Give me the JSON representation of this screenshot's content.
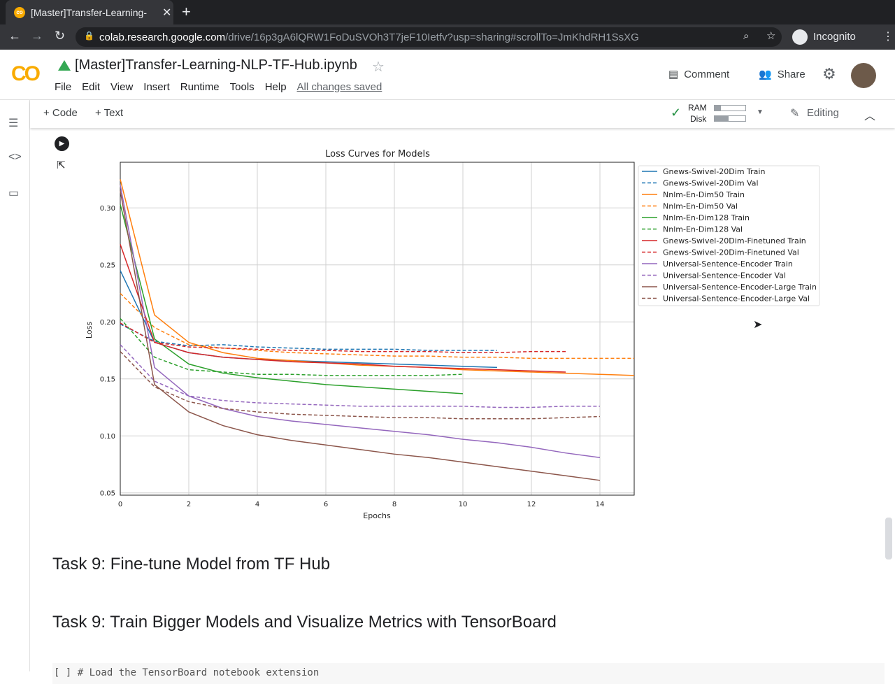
{
  "browser": {
    "tab_title": "[Master]Transfer-Learning-",
    "url_host": "colab.research.google.com",
    "url_path": "/drive/16p3gA6lQRW1FoDuSVOh3T7jeF10Ietfv?usp=sharing#scrollTo=JmKhdRH1SsXG",
    "incognito_label": "Incognito"
  },
  "header": {
    "logo": "CO",
    "notebook_title": "[Master]Transfer-Learning-NLP-TF-Hub.ipynb",
    "menu": [
      "File",
      "Edit",
      "View",
      "Insert",
      "Runtime",
      "Tools",
      "Help"
    ],
    "save_status": "All changes saved",
    "comment": "Comment",
    "share": "Share"
  },
  "toolbar": {
    "add_code": "+ Code",
    "add_text": "+ Text",
    "ram": "RAM",
    "disk": "Disk",
    "ram_usage": 0.2,
    "disk_usage": 0.45,
    "editing": "Editing"
  },
  "cells": {
    "task9a": "Task 9: Fine-tune Model from TF Hub",
    "task9b": "Task 9: Train Bigger Models and Visualize Metrics with TensorBoard",
    "code_peek": "[ ]  # Load the TensorBoard notebook extension"
  },
  "chart_data": {
    "type": "line",
    "title": "Loss Curves for Models",
    "xlabel": "Epochs",
    "ylabel": "Loss",
    "xlim": [
      0,
      15
    ],
    "ylim": [
      0.048,
      0.34
    ],
    "grid": true,
    "legend_position": "outside-right",
    "xticks": [
      0,
      2,
      4,
      6,
      8,
      10,
      12,
      14
    ],
    "yticks": [
      0.05,
      0.1,
      0.15,
      0.2,
      0.25,
      0.3
    ],
    "series": [
      {
        "name": "Gnews-Swivel-20Dim Train",
        "color": "#1f77b4",
        "dash": false,
        "values": [
          0.245,
          0.182,
          0.173,
          0.169,
          0.167,
          0.166,
          0.165,
          0.164,
          0.163,
          0.162,
          0.161,
          0.16
        ]
      },
      {
        "name": "Gnews-Swivel-20Dim Val",
        "color": "#1f77b4",
        "dash": true,
        "values": [
          0.198,
          0.183,
          0.179,
          0.18,
          0.178,
          0.177,
          0.176,
          0.176,
          0.176,
          0.175,
          0.175,
          0.175
        ]
      },
      {
        "name": "Nnlm-En-Dim50 Train",
        "color": "#ff7f0e",
        "dash": false,
        "values": [
          0.325,
          0.206,
          0.182,
          0.173,
          0.168,
          0.166,
          0.164,
          0.162,
          0.161,
          0.16,
          0.158,
          0.157,
          0.156,
          0.155,
          0.154,
          0.153
        ]
      },
      {
        "name": "Nnlm-En-Dim50 Val",
        "color": "#ff7f0e",
        "dash": true,
        "values": [
          0.225,
          0.195,
          0.18,
          0.177,
          0.175,
          0.173,
          0.172,
          0.171,
          0.17,
          0.17,
          0.169,
          0.169,
          0.168,
          0.168,
          0.168,
          0.168
        ]
      },
      {
        "name": "Nnlm-En-Dim128 Train",
        "color": "#2ca02c",
        "dash": false,
        "values": [
          0.303,
          0.185,
          0.163,
          0.155,
          0.151,
          0.148,
          0.145,
          0.143,
          0.141,
          0.139,
          0.137
        ]
      },
      {
        "name": "Nnlm-En-Dim128 Val",
        "color": "#2ca02c",
        "dash": true,
        "values": [
          0.203,
          0.169,
          0.158,
          0.156,
          0.154,
          0.154,
          0.153,
          0.153,
          0.153,
          0.153,
          0.154
        ]
      },
      {
        "name": "Gnews-Swivel-20Dim-Finetuned Train",
        "color": "#d62728",
        "dash": false,
        "values": [
          0.268,
          0.182,
          0.173,
          0.169,
          0.167,
          0.165,
          0.164,
          0.163,
          0.161,
          0.16,
          0.159,
          0.158,
          0.157,
          0.156
        ]
      },
      {
        "name": "Gnews-Swivel-20Dim-Finetuned Val",
        "color": "#d62728",
        "dash": true,
        "values": [
          0.199,
          0.182,
          0.178,
          0.177,
          0.176,
          0.175,
          0.175,
          0.174,
          0.174,
          0.174,
          0.173,
          0.173,
          0.174,
          0.174
        ]
      },
      {
        "name": "Universal-Sentence-Encoder Train",
        "color": "#9467bd",
        "dash": false,
        "values": [
          0.32,
          0.16,
          0.135,
          0.124,
          0.117,
          0.113,
          0.11,
          0.107,
          0.104,
          0.101,
          0.097,
          0.094,
          0.09,
          0.085,
          0.081
        ]
      },
      {
        "name": "Universal-Sentence-Encoder Val",
        "color": "#9467bd",
        "dash": true,
        "values": [
          0.18,
          0.148,
          0.135,
          0.131,
          0.129,
          0.128,
          0.127,
          0.126,
          0.126,
          0.126,
          0.126,
          0.125,
          0.125,
          0.126,
          0.126
        ]
      },
      {
        "name": "Universal-Sentence-Encoder-Large Train",
        "color": "#8c564b",
        "dash": false,
        "values": [
          0.315,
          0.145,
          0.121,
          0.109,
          0.101,
          0.096,
          0.092,
          0.088,
          0.084,
          0.081,
          0.077,
          0.073,
          0.069,
          0.065,
          0.061
        ]
      },
      {
        "name": "Universal-Sentence-Encoder-Large Val",
        "color": "#8c564b",
        "dash": true,
        "values": [
          0.174,
          0.143,
          0.13,
          0.124,
          0.121,
          0.119,
          0.118,
          0.117,
          0.116,
          0.116,
          0.115,
          0.115,
          0.115,
          0.116,
          0.117
        ]
      }
    ]
  }
}
